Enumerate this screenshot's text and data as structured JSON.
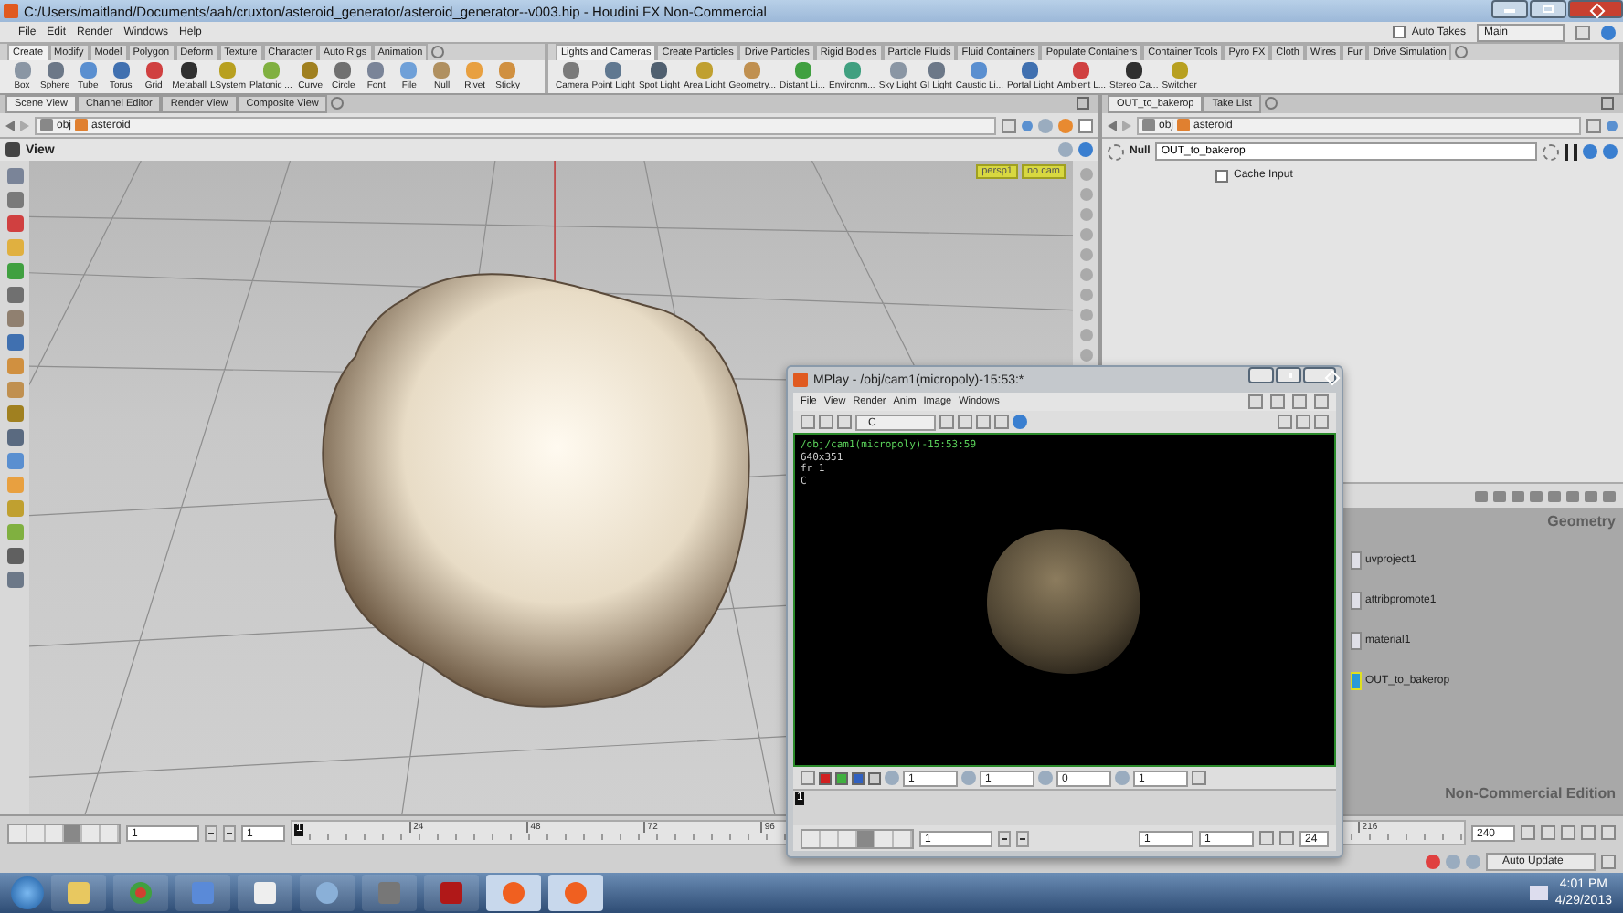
{
  "window": {
    "title": "C:/Users/maitland/Documents/aah/cruxton/asteroid_generator/asteroid_generator--v003.hip - Houdini FX Non-Commercial"
  },
  "menu": [
    "File",
    "Edit",
    "Render",
    "Windows",
    "Help"
  ],
  "auto_takes": {
    "label": "Auto Takes",
    "checked": false
  },
  "take": {
    "value": "Main"
  },
  "shelves": [
    {
      "tabs": [
        {
          "label": "Create",
          "selected": true
        },
        {
          "label": "Modify",
          "selected": false
        },
        {
          "label": "Model",
          "selected": false
        },
        {
          "label": "Polygon",
          "selected": false
        },
        {
          "label": "Deform",
          "selected": false
        },
        {
          "label": "Texture",
          "selected": false
        },
        {
          "label": "Character",
          "selected": false
        },
        {
          "label": "Auto Rigs",
          "selected": false
        },
        {
          "label": "Animation",
          "selected": false
        }
      ],
      "tools": [
        "Box",
        "Sphere",
        "Tube",
        "Torus",
        "Grid",
        "Metaball",
        "LSystem",
        "Platonic ...",
        "Curve",
        "Circle",
        "Font",
        "File",
        "Null",
        "Rivet",
        "Sticky"
      ]
    },
    {
      "tabs": [
        {
          "label": "Lights and Cameras",
          "selected": true
        },
        {
          "label": "Create Particles",
          "selected": false
        },
        {
          "label": "Drive Particles",
          "selected": false
        },
        {
          "label": "Rigid Bodies",
          "selected": false
        },
        {
          "label": "Particle Fluids",
          "selected": false
        },
        {
          "label": "Fluid Containers",
          "selected": false
        },
        {
          "label": "Populate Containers",
          "selected": false
        },
        {
          "label": "Container Tools",
          "selected": false
        },
        {
          "label": "Pyro FX",
          "selected": false
        },
        {
          "label": "Cloth",
          "selected": false
        },
        {
          "label": "Wires",
          "selected": false
        },
        {
          "label": "Fur",
          "selected": false
        },
        {
          "label": "Drive Simulation",
          "selected": false
        }
      ],
      "tools": [
        "Camera",
        "Point Light",
        "Spot Light",
        "Area Light",
        "Geometry...",
        "Distant Li...",
        "Environm...",
        "Sky Light",
        "GI Light",
        "Caustic Li...",
        "Portal Light",
        "Ambient L...",
        "Stereo Ca...",
        "Switcher"
      ]
    }
  ],
  "left_pane": {
    "tabs": [
      {
        "label": "Scene View",
        "selected": true
      },
      {
        "label": "Channel Editor",
        "selected": false
      },
      {
        "label": "Render View",
        "selected": false
      },
      {
        "label": "Composite View",
        "selected": false
      }
    ],
    "path": [
      "obj",
      "asteroid"
    ],
    "viewport": {
      "title": "View",
      "camera_labels": [
        "persp1",
        "no cam"
      ]
    }
  },
  "right_pane": {
    "tabs": [
      {
        "label": "OUT_to_bakerop",
        "selected": true
      },
      {
        "label": "Take List",
        "selected": false
      }
    ],
    "path": [
      "obj",
      "asteroid"
    ],
    "parameters": {
      "node_type": "Null",
      "node_name": "OUT_to_bakerop",
      "cache_input": {
        "label": "Cache Input",
        "checked": false
      }
    },
    "network": {
      "context": "Geometry",
      "edition": "Non-Commercial Edition",
      "nodes": [
        {
          "name": "uvproject1",
          "selected": false
        },
        {
          "name": "attribpromote1",
          "selected": false
        },
        {
          "name": "material1",
          "selected": false
        },
        {
          "name": "OUT_to_bakerop",
          "selected": true
        }
      ]
    }
  },
  "mplay": {
    "title": "MPlay - /obj/cam1(micropoly)-15:53:*",
    "menu": [
      "File",
      "View",
      "Render",
      "Anim",
      "Image",
      "Windows"
    ],
    "plane": "C",
    "info": [
      "/obj/cam1(micropoly)-15:53:59",
      "640x351",
      "fr 1",
      "C"
    ],
    "image_controls": [
      "1",
      "1",
      "0",
      "1"
    ],
    "frame_marker": "1",
    "frame": "1",
    "range": [
      "1",
      "1"
    ],
    "fps": "24"
  },
  "playbar": {
    "frame": "1",
    "start": "1",
    "current_marker": "1",
    "ticks": [
      "24",
      "48",
      "72",
      "96",
      "216"
    ],
    "end": "240",
    "update_mode": "Auto Update"
  },
  "taskbar": {
    "time": "4:01 PM",
    "date": "4/29/2013"
  }
}
